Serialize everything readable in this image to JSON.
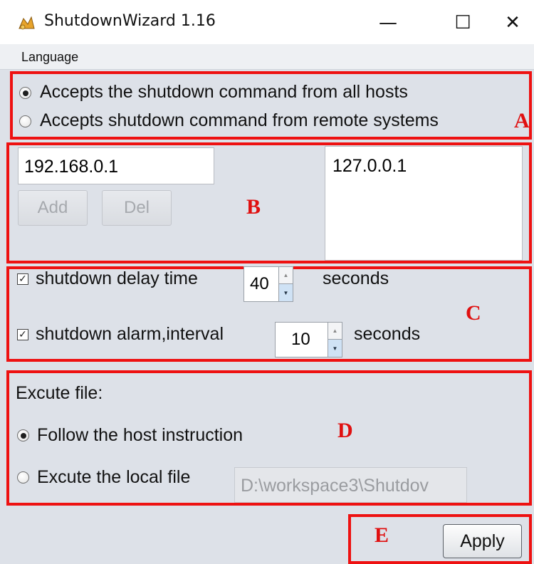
{
  "window": {
    "title": "ShutdownWizard 1.16",
    "min_glyph": "—",
    "max_glyph": "☐",
    "close_glyph": "✕"
  },
  "menu": {
    "language": "Language"
  },
  "access": {
    "option_all": "Accepts the shutdown command from all hosts",
    "option_remote": "Accepts shutdown command from remote systems",
    "selected": "all"
  },
  "hosts": {
    "ip_input_value": "192.168.0.1",
    "add_label": "Add",
    "del_label": "Del",
    "list": [
      "127.0.0.1"
    ]
  },
  "timing": {
    "delay_label": "shutdown delay time",
    "delay_value": "40",
    "delay_unit": "seconds",
    "alarm_label": "shutdown alarm,interval",
    "alarm_value": "10",
    "alarm_unit": "seconds",
    "check_glyph": "✓"
  },
  "execute": {
    "heading": "Excute file:",
    "option_follow": "Follow the host instruction",
    "option_local": "Excute the local file",
    "local_path": "D:\\workspace3\\Shutdov",
    "selected": "follow"
  },
  "footer": {
    "apply_label": "Apply"
  },
  "annotations": {
    "a": "A",
    "b": "B",
    "c": "C",
    "d": "D",
    "e": "E"
  },
  "colors": {
    "annotation_red": "#ee1111",
    "window_bg": "#dde1e8"
  }
}
